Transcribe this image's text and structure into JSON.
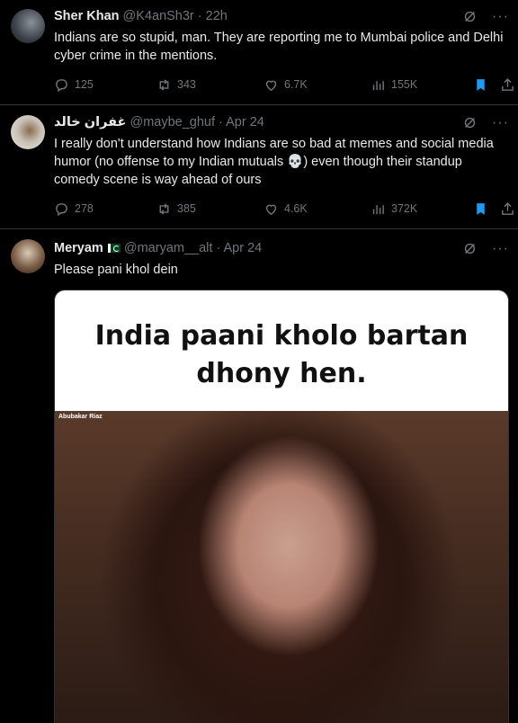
{
  "tweets": [
    {
      "name": "Sher Khan",
      "handle": "@K4anSh3r",
      "time": "22h",
      "text": "Indians are so stupid, man. They are reporting me to Mumbai police and Delhi cyber crime in the mentions.",
      "replies": "125",
      "retweets": "343",
      "likes": "6.7K",
      "views": "155K"
    },
    {
      "name": "غفران خالد",
      "handle": "@maybe_ghuf",
      "time": "Apr 24",
      "text": "I really don't understand how Indians are so bad at memes and social media humor (no offense to my Indian mutuals 💀) even though their standup comedy scene is way ahead of ours",
      "replies": "278",
      "retweets": "385",
      "likes": "4.6K",
      "views": "372K"
    },
    {
      "name": "Meryam",
      "handle": "@maryam__alt",
      "time": "Apr 24",
      "text": "Please pani khol dein",
      "media": {
        "caption": "India paani kholo bartan dhony hen.",
        "credit": "Abubakar Riaz"
      }
    }
  ],
  "separator": "·",
  "more": "···",
  "colors": {
    "background": "#000000",
    "text": "#e7e9ea",
    "muted": "#71767b",
    "accent": "#1d9bf0",
    "border": "#2f3336"
  }
}
